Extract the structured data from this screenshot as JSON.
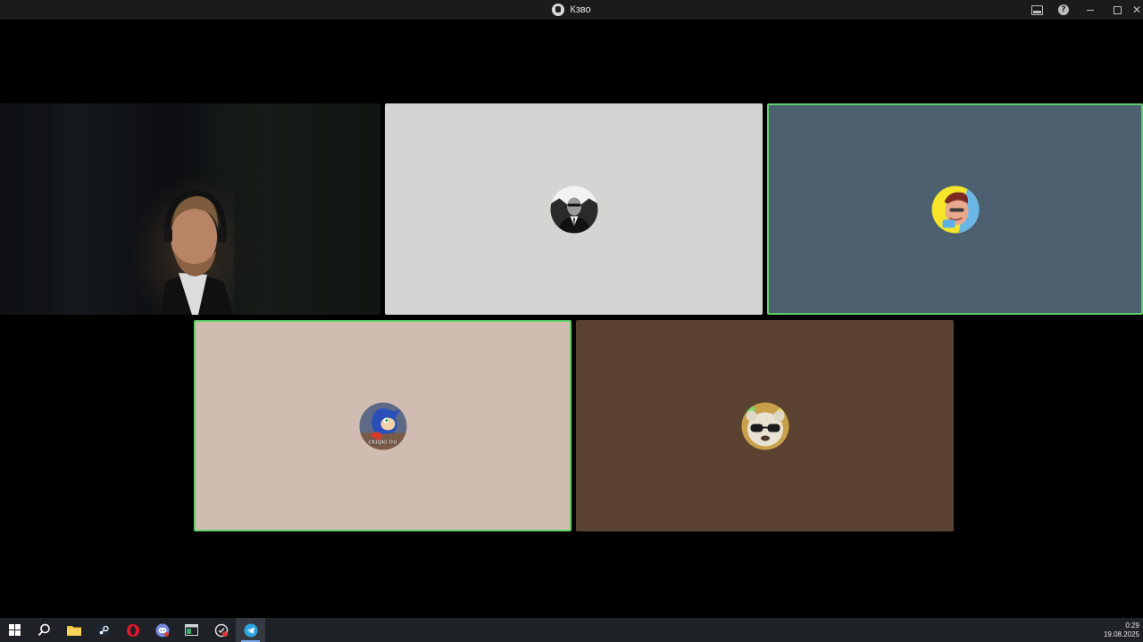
{
  "window": {
    "title": "Кзво",
    "actions": [
      "screen-share-icon",
      "help-icon",
      "minimize-icon",
      "maximize-icon",
      "close-icon"
    ]
  },
  "participants": [
    {
      "id": "p1",
      "type": "video",
      "speaking": false
    },
    {
      "id": "p2",
      "type": "avatar",
      "avatar_icon": "man-in-suit-avatar",
      "bg": "#d4d4d2",
      "speaking": false
    },
    {
      "id": "p3",
      "type": "avatar",
      "avatar_icon": "cartoon-hero-avatar",
      "bg": "#4d6070",
      "speaking": true
    },
    {
      "id": "p4",
      "type": "avatar",
      "avatar_icon": "sonic-avatar",
      "avatar_caption": "скоро пи",
      "bg": "#d0bcb1",
      "speaking": true
    },
    {
      "id": "p5",
      "type": "avatar",
      "avatar_icon": "bear-with-sunglasses-avatar",
      "bg": "#5b4230",
      "speaking": false
    }
  ],
  "speaking_color": "#5fd06a",
  "taskbar": {
    "apps": [
      "windows-start-icon",
      "search-icon",
      "file-explorer-icon",
      "steam-icon",
      "opera-icon",
      "discord-icon",
      "window-app-icon",
      "vpn-app-icon",
      "telegram-icon"
    ],
    "active_app": "telegram-icon",
    "time": "0:29",
    "date": "19.08.2025"
  }
}
